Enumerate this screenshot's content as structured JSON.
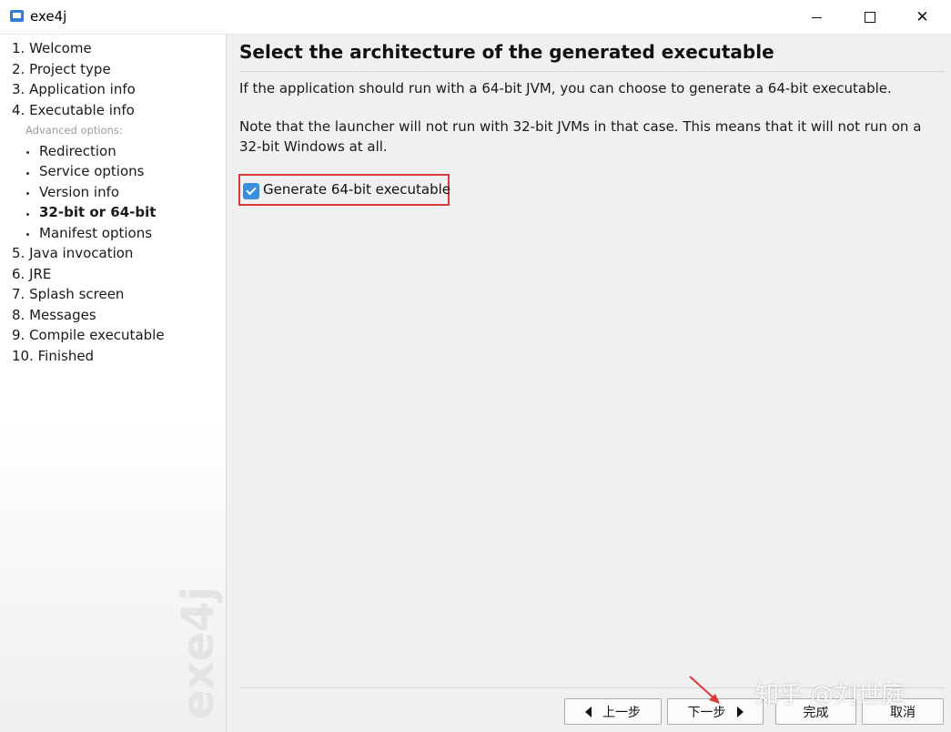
{
  "window": {
    "title": "exe4j"
  },
  "sidebar": {
    "steps": [
      {
        "label": "1. Welcome"
      },
      {
        "label": "2. Project type"
      },
      {
        "label": "3. Application info"
      },
      {
        "label": "4. Executable info"
      }
    ],
    "advanced_label": "Advanced options:",
    "substeps": [
      {
        "label": "Redirection"
      },
      {
        "label": "Service options"
      },
      {
        "label": "Version info"
      },
      {
        "label": "32-bit or 64-bit",
        "active": true
      },
      {
        "label": "Manifest options"
      }
    ],
    "steps_after": [
      {
        "label": "5. Java invocation"
      },
      {
        "label": "6. JRE"
      },
      {
        "label": "7. Splash screen"
      },
      {
        "label": "8. Messages"
      },
      {
        "label": "9. Compile executable"
      },
      {
        "label": "10. Finished"
      }
    ],
    "watermark": "exe4j"
  },
  "main": {
    "heading": "Select the architecture of the generated executable",
    "paragraph1": "If the application should run with a 64-bit JVM, you can choose to generate a 64-bit executable.",
    "paragraph2": "Note that the launcher will not run with 32-bit JVMs in that case. This means that it will not run on a 32-bit Windows at all.",
    "checkbox": {
      "label": "Generate 64-bit executable",
      "checked": true
    }
  },
  "footer": {
    "prev_label": "上一步",
    "next_label": "下一步",
    "finish_label": "完成",
    "cancel_label": "取消"
  },
  "overlay": {
    "watermark_text": "知乎 @刘世庭"
  },
  "colors": {
    "checkbox": "#3a8fdc",
    "highlight": "#d93a3a"
  }
}
